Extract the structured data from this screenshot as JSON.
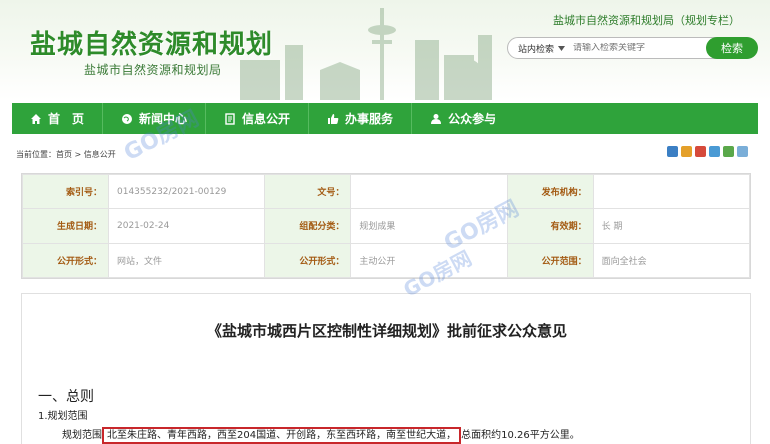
{
  "header": {
    "site_title": "盐城自然资源和规划",
    "site_subtitle": "盐城市自然资源和规划局",
    "column_link": "盐城市自然资源和规划局（规划专栏）",
    "search_scope": "站内检索",
    "search_placeholder": "请输入检索关键字",
    "search_button": "检索"
  },
  "nav": {
    "items": [
      {
        "label": "首　页",
        "icon": "home-icon"
      },
      {
        "label": "新闻中心",
        "icon": "globe-icon"
      },
      {
        "label": "信息公开",
        "icon": "document-icon"
      },
      {
        "label": "办事服务",
        "icon": "thumbs-up-icon"
      },
      {
        "label": "公众参与",
        "icon": "user-icon"
      }
    ]
  },
  "breadcrumb": "当前位置：首页 > 信息公开",
  "meta": {
    "index_no_label": "索引号：",
    "index_no": "014355232/2021-00129",
    "doc_no_label": "文号：",
    "doc_no": "",
    "publisher_label": "发布机构：",
    "publisher": "",
    "date_label": "生成日期：",
    "date": "2021-02-24",
    "category_label": "组配分类：",
    "category": "规划成果",
    "validity_label": "有效期：",
    "validity": "长 期",
    "form1_label": "公开形式：",
    "form1": "网站，文件",
    "form2_label": "公开形式：",
    "form2": "主动公开",
    "scope_label": "公开范围：",
    "scope": "面向全社会"
  },
  "article": {
    "title": "《盐城市城西片区控制性详细规划》批前征求公众意见",
    "section": "一、总则",
    "subsection": "1.规划范围",
    "scope_prefix": "规划范围",
    "scope_highlight": "北至朱庄路、青年西路，西至204国道、开创路，东至西环路，南至世纪大道，",
    "scope_suffix": "总面积约10.26平方公里。"
  },
  "watermark": "GO房网",
  "colors": {
    "brand_green": "#2fa33b",
    "highlight_red": "#c8272b",
    "label_brown": "#a35a12"
  }
}
